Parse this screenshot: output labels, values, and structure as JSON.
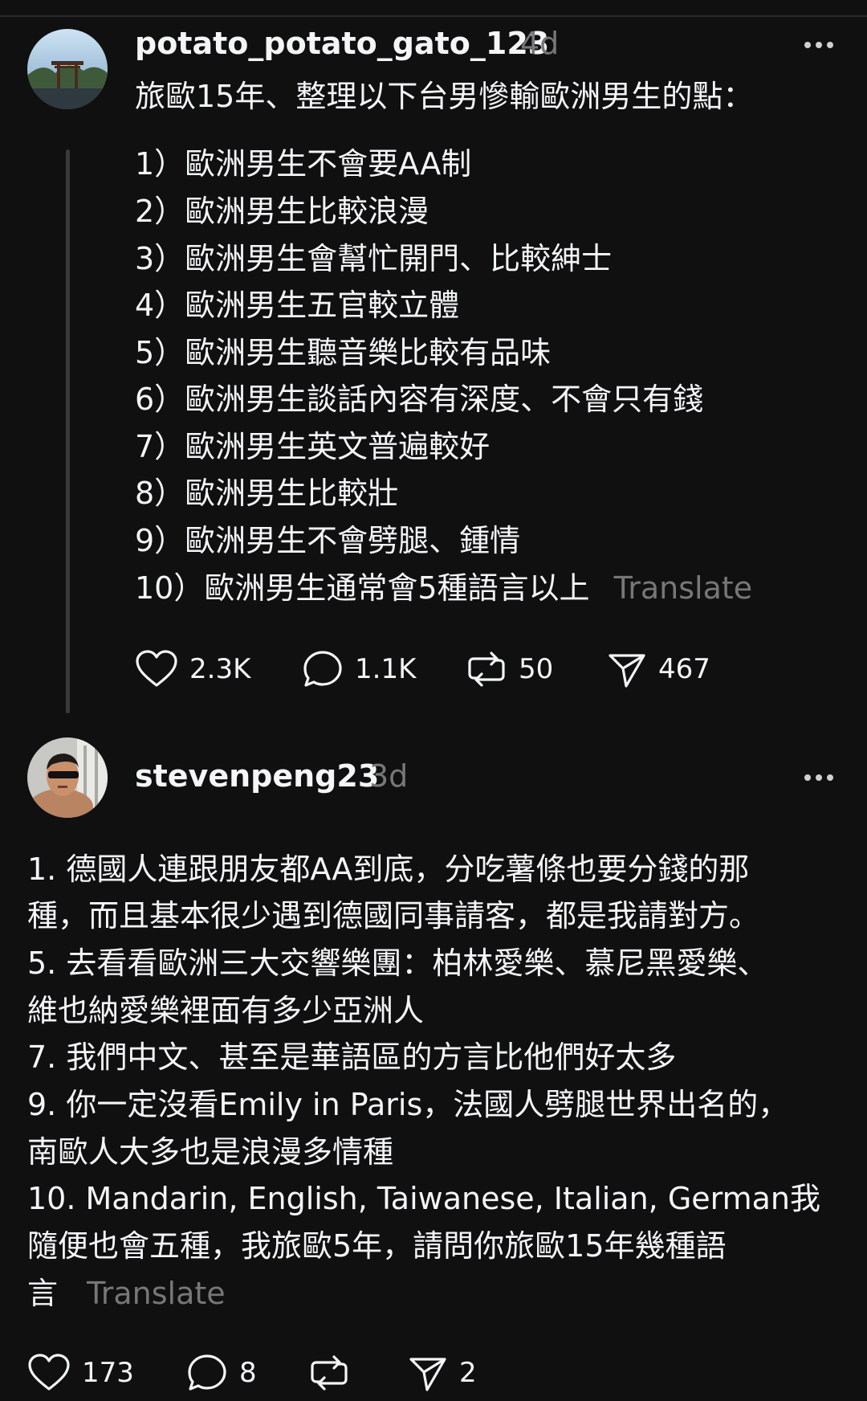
{
  "post": {
    "username": "potato_potato_gato_123",
    "time": "4d",
    "intro": "旅歐15年、整理以下台男慘輸歐洲男生的點：",
    "items": [
      "1）歐洲男生不會要AA制",
      "2）歐洲男生比較浪漫",
      "3）歐洲男生會幫忙開門、比較紳士",
      "4）歐洲男生五官較立體",
      "5）歐洲男生聽音樂比較有品味",
      "6）歐洲男生談話內容有深度、不會只有錢",
      "7）歐洲男生英文普遍較好",
      "8）歐洲男生比較壯",
      "9）歐洲男生不會劈腿、鍾情",
      "10）歐洲男生通常會5種語言以上"
    ],
    "translate": "Translate",
    "likes": "2.3K",
    "replies": "1.1K",
    "reposts": "50",
    "shares": "467"
  },
  "reply": {
    "username": "stevenpeng23",
    "time": "3d",
    "lines": [
      "1. 德國人連跟朋友都AA到底，分吃薯條也要分錢的那",
      "種，而且基本很少遇到德國同事請客，都是我請對方。",
      "5. 去看看歐洲三大交響樂團：柏林愛樂、慕尼黑愛樂、",
      "維也納愛樂裡面有多少亞洲人",
      "7. 我們中文、甚至是華語區的方言比他們好太多",
      "9. 你一定沒看Emily in Paris，法國人劈腿世界出名的，",
      "南歐人大多也是浪漫多情種",
      "10. Mandarin, English, Taiwanese, Italian, German我",
      "隨便也會五種，我旅歐5年，請問你旅歐15年幾種語",
      "言"
    ],
    "translate": "Translate",
    "likes": "173",
    "replies": "8",
    "shares": "2"
  },
  "icons": {
    "like": "heart-icon",
    "reply": "comment-icon",
    "repost": "repost-icon",
    "share": "send-icon",
    "more": "more-icon"
  }
}
